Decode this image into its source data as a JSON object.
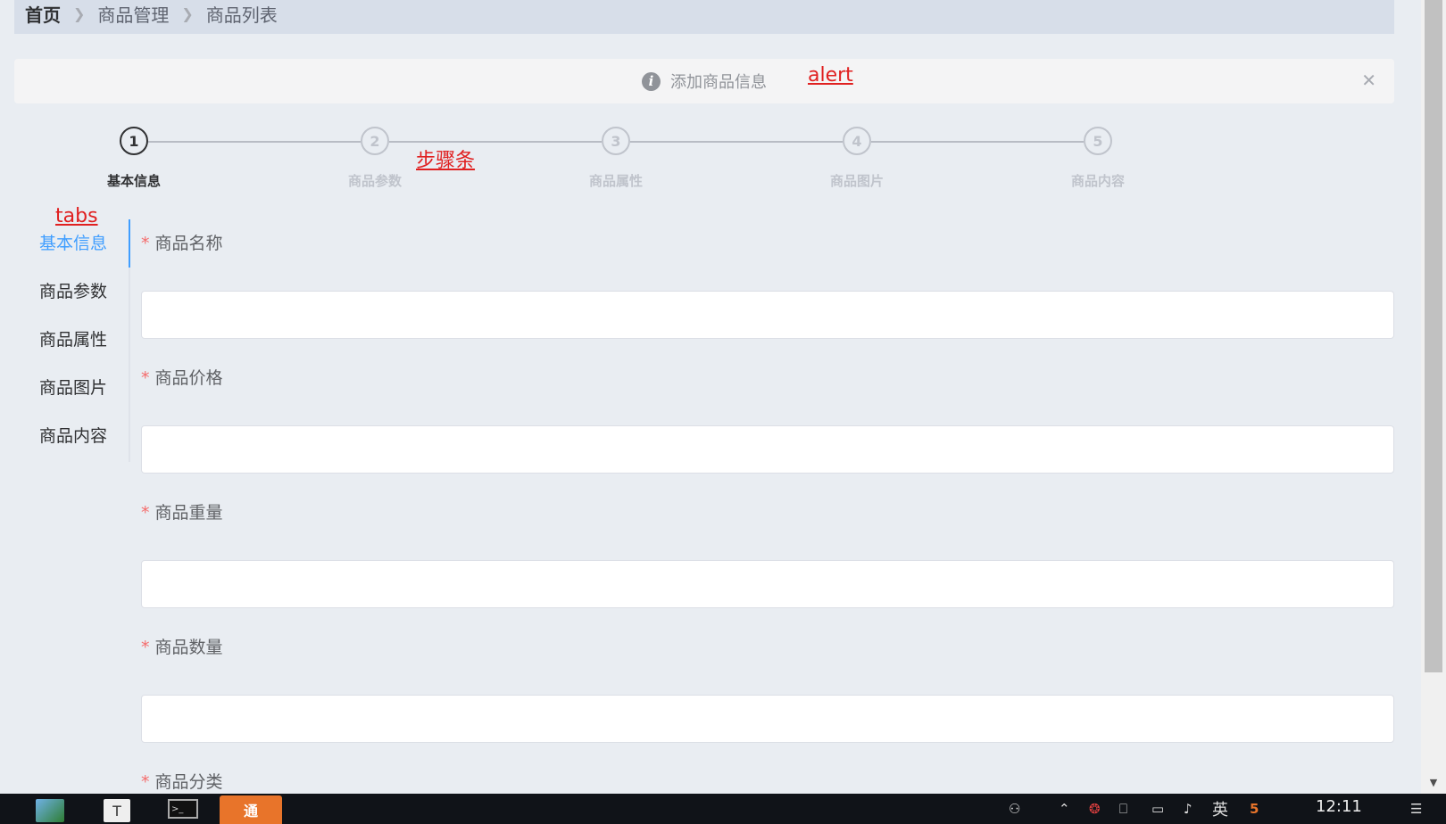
{
  "breadcrumb": {
    "home": "首页",
    "items": [
      "商品管理",
      "商品列表"
    ]
  },
  "alert": {
    "text": "添加商品信息",
    "icon": "info-icon",
    "close_icon": "close-icon"
  },
  "annotations": {
    "alert": "alert",
    "steps": "步骤条",
    "tabs": "tabs"
  },
  "steps": {
    "active_index": 0,
    "items": [
      {
        "number": "1",
        "title": "基本信息"
      },
      {
        "number": "2",
        "title": "商品参数"
      },
      {
        "number": "3",
        "title": "商品属性"
      },
      {
        "number": "4",
        "title": "商品图片"
      },
      {
        "number": "5",
        "title": "商品内容"
      }
    ]
  },
  "tabs": {
    "active_index": 0,
    "items": [
      "基本信息",
      "商品参数",
      "商品属性",
      "商品图片",
      "商品内容"
    ]
  },
  "form": {
    "required_mark": "*",
    "fields": [
      {
        "label": "商品名称",
        "value": ""
      },
      {
        "label": "商品价格",
        "value": ""
      },
      {
        "label": "商品重量",
        "value": ""
      },
      {
        "label": "商品数量",
        "value": ""
      },
      {
        "label": "商品分类",
        "value": ""
      }
    ]
  },
  "taskbar": {
    "active_app_label": "通",
    "text_app_label": "T",
    "ime_label": "英",
    "clock": "12:11"
  },
  "colors": {
    "primary": "#409eff",
    "required": "#f56c6c",
    "annotation": "#e02020",
    "taskbar_active": "#e8742a"
  }
}
